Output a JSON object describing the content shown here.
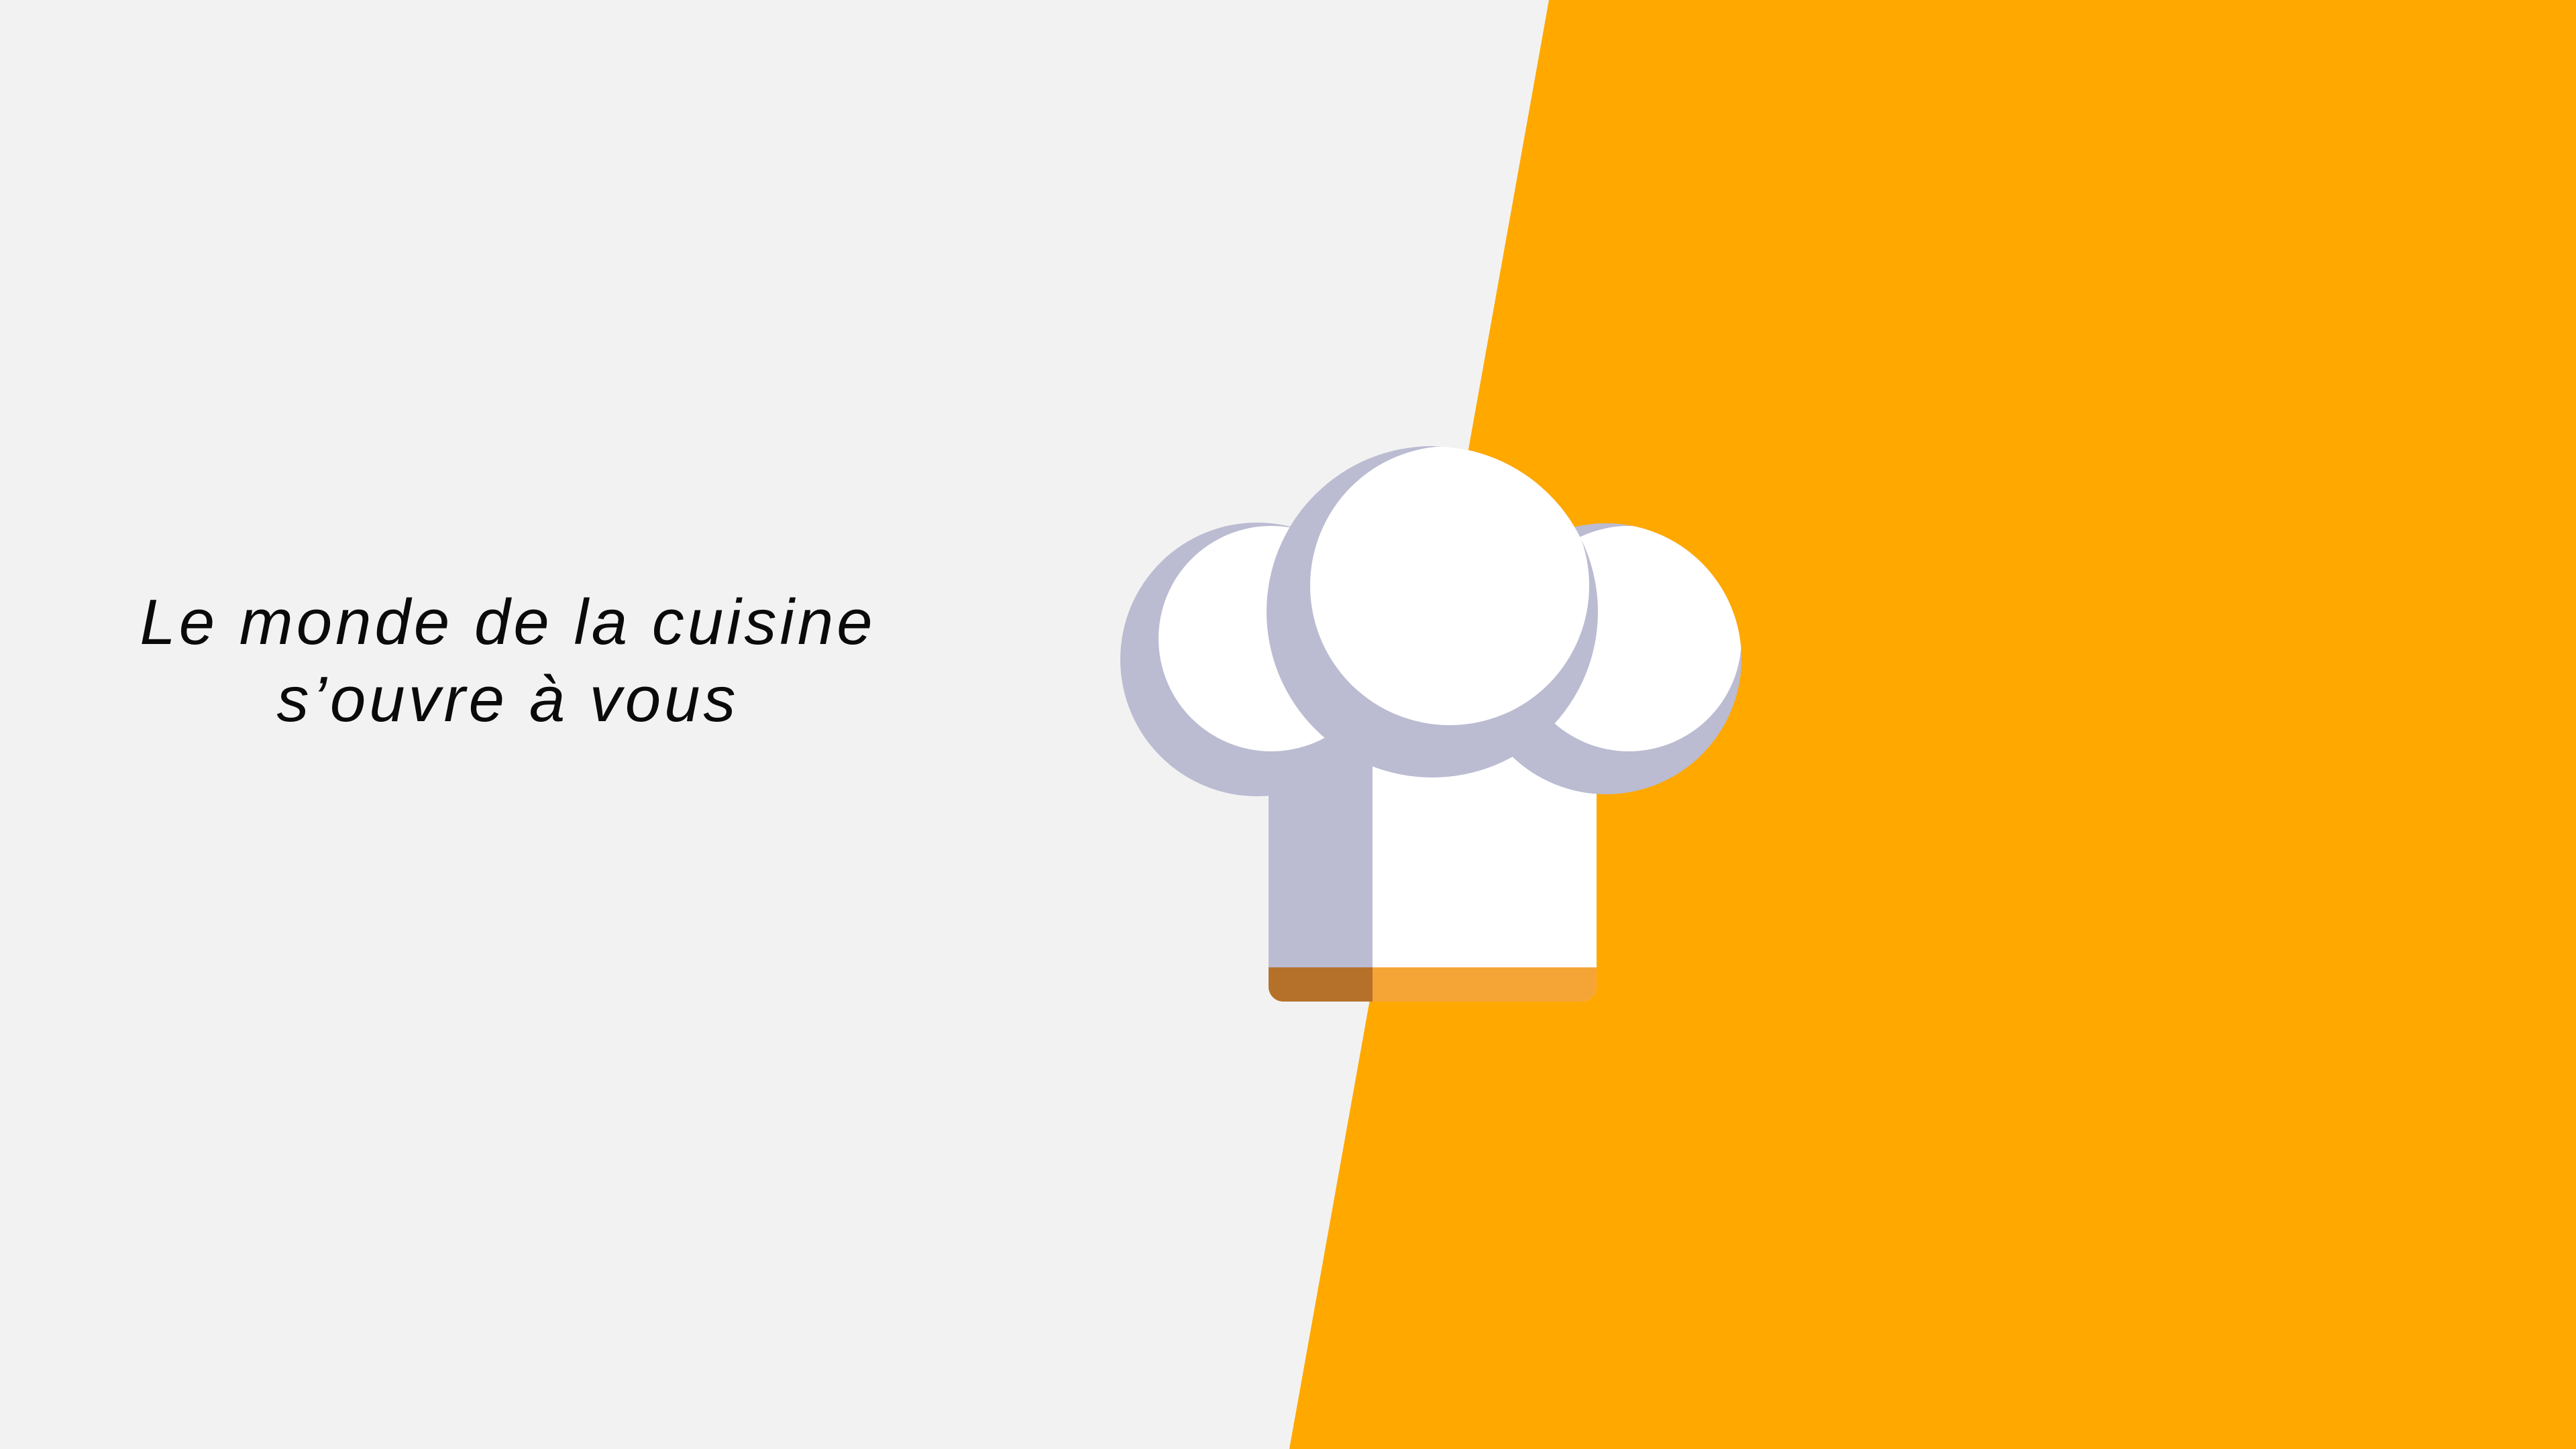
{
  "slide": {
    "tagline": {
      "line1": "Le monde de la cuisine",
      "line2": "s’ouvre à vous"
    },
    "illustration": "chef-hat-icon",
    "colors": {
      "background": "#f2f2f2",
      "accent": "#ffa800",
      "hat_shadow": "#bbbbd2",
      "hat_white": "#ffffff",
      "hat_band": "#f5a536"
    }
  }
}
